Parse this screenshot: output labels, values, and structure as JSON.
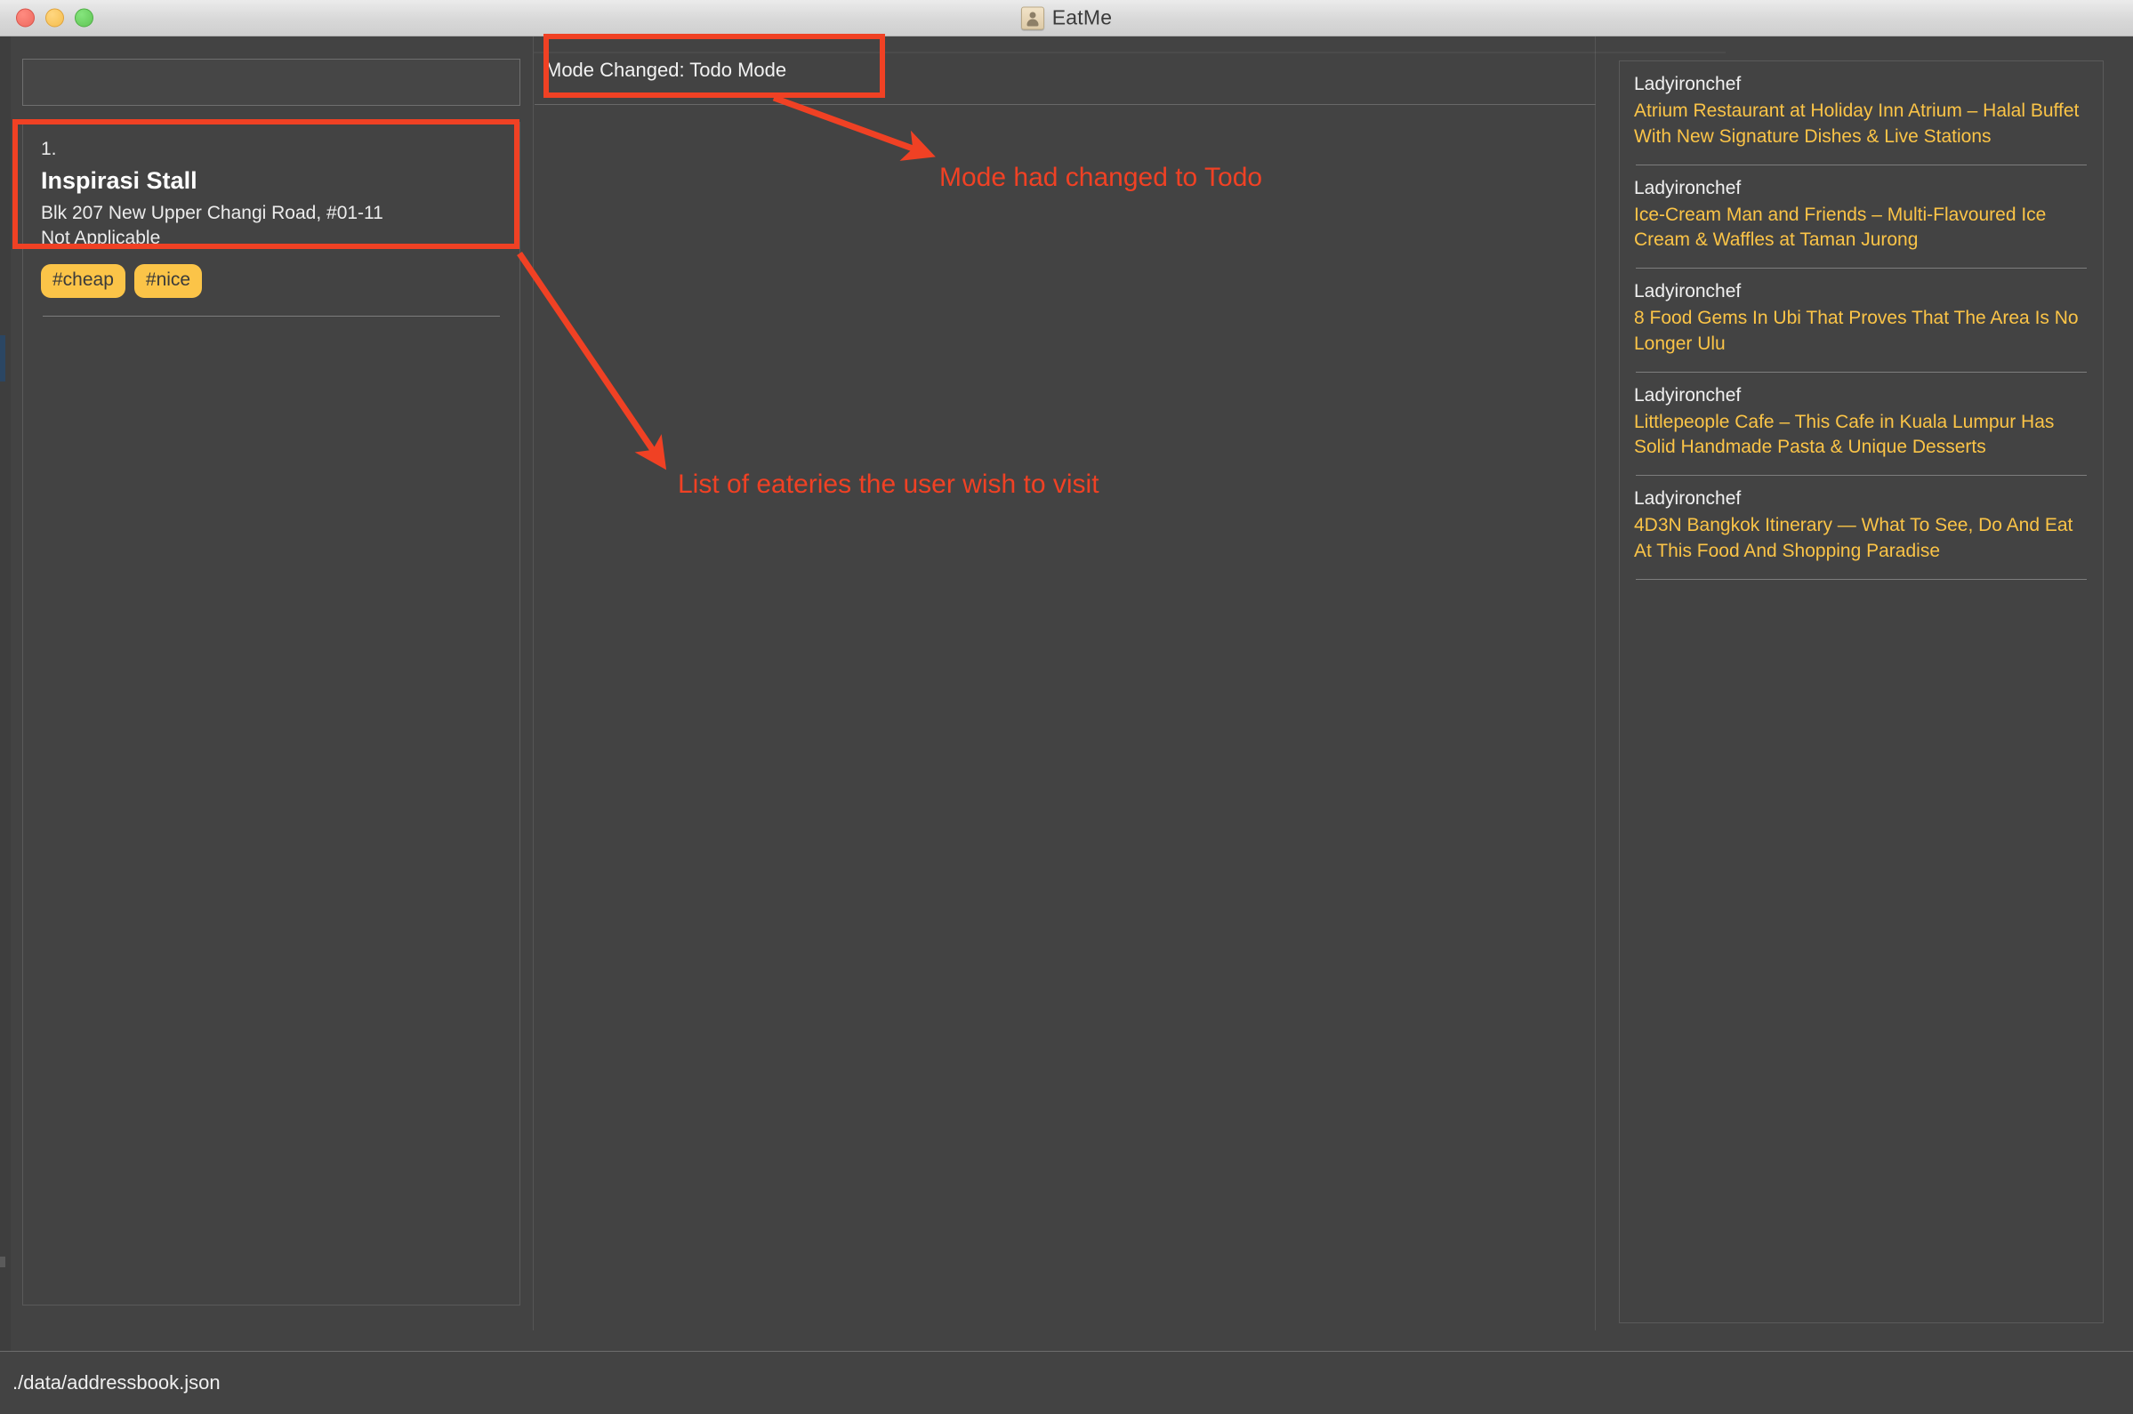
{
  "window": {
    "title": "EatMe",
    "app_icon": "address-book-icon",
    "controls": [
      "close",
      "minimize",
      "maximize"
    ]
  },
  "left_panel": {
    "search": {
      "value": "",
      "placeholder": ""
    },
    "todo_list": [
      {
        "index": "1.",
        "name": "Inspirasi Stall",
        "address": "Blk 207 New Upper Changi Road, #01-11",
        "extra": "Not Applicable",
        "tags": [
          "#cheap",
          "#nice"
        ]
      }
    ]
  },
  "middle_panel": {
    "result_text": "Mode Changed: Todo Mode"
  },
  "right_panel": {
    "feed": [
      {
        "source": "Ladyironchef",
        "headline": "Atrium Restaurant at Holiday Inn Atrium – Halal Buffet With New Signature Dishes & Live Stations"
      },
      {
        "source": "Ladyironchef",
        "headline": "Ice-Cream Man and Friends – Multi-Flavoured Ice Cream & Waffles at Taman Jurong"
      },
      {
        "source": "Ladyironchef",
        "headline": "8 Food Gems In Ubi That Proves That The Area Is No Longer Ulu"
      },
      {
        "source": "Ladyironchef",
        "headline": "Littlepeople Cafe – This Cafe in Kuala Lumpur Has Solid Handmade Pasta & Unique Desserts"
      },
      {
        "source": "Ladyironchef",
        "headline": "4D3N Bangkok Itinerary — What To See, Do And Eat At This Food And Shopping Paradise"
      }
    ]
  },
  "status_bar": {
    "path": "./data/addressbook.json"
  },
  "annotations": [
    {
      "id": "mode",
      "text": "Mode had changed to Todo"
    },
    {
      "id": "list",
      "text": "List of eateries the user wish to visit"
    }
  ],
  "colors": {
    "annotation": "#f04124",
    "tag_background": "#fbc448",
    "headline": "#fbc447",
    "panel_background": "#434343"
  }
}
